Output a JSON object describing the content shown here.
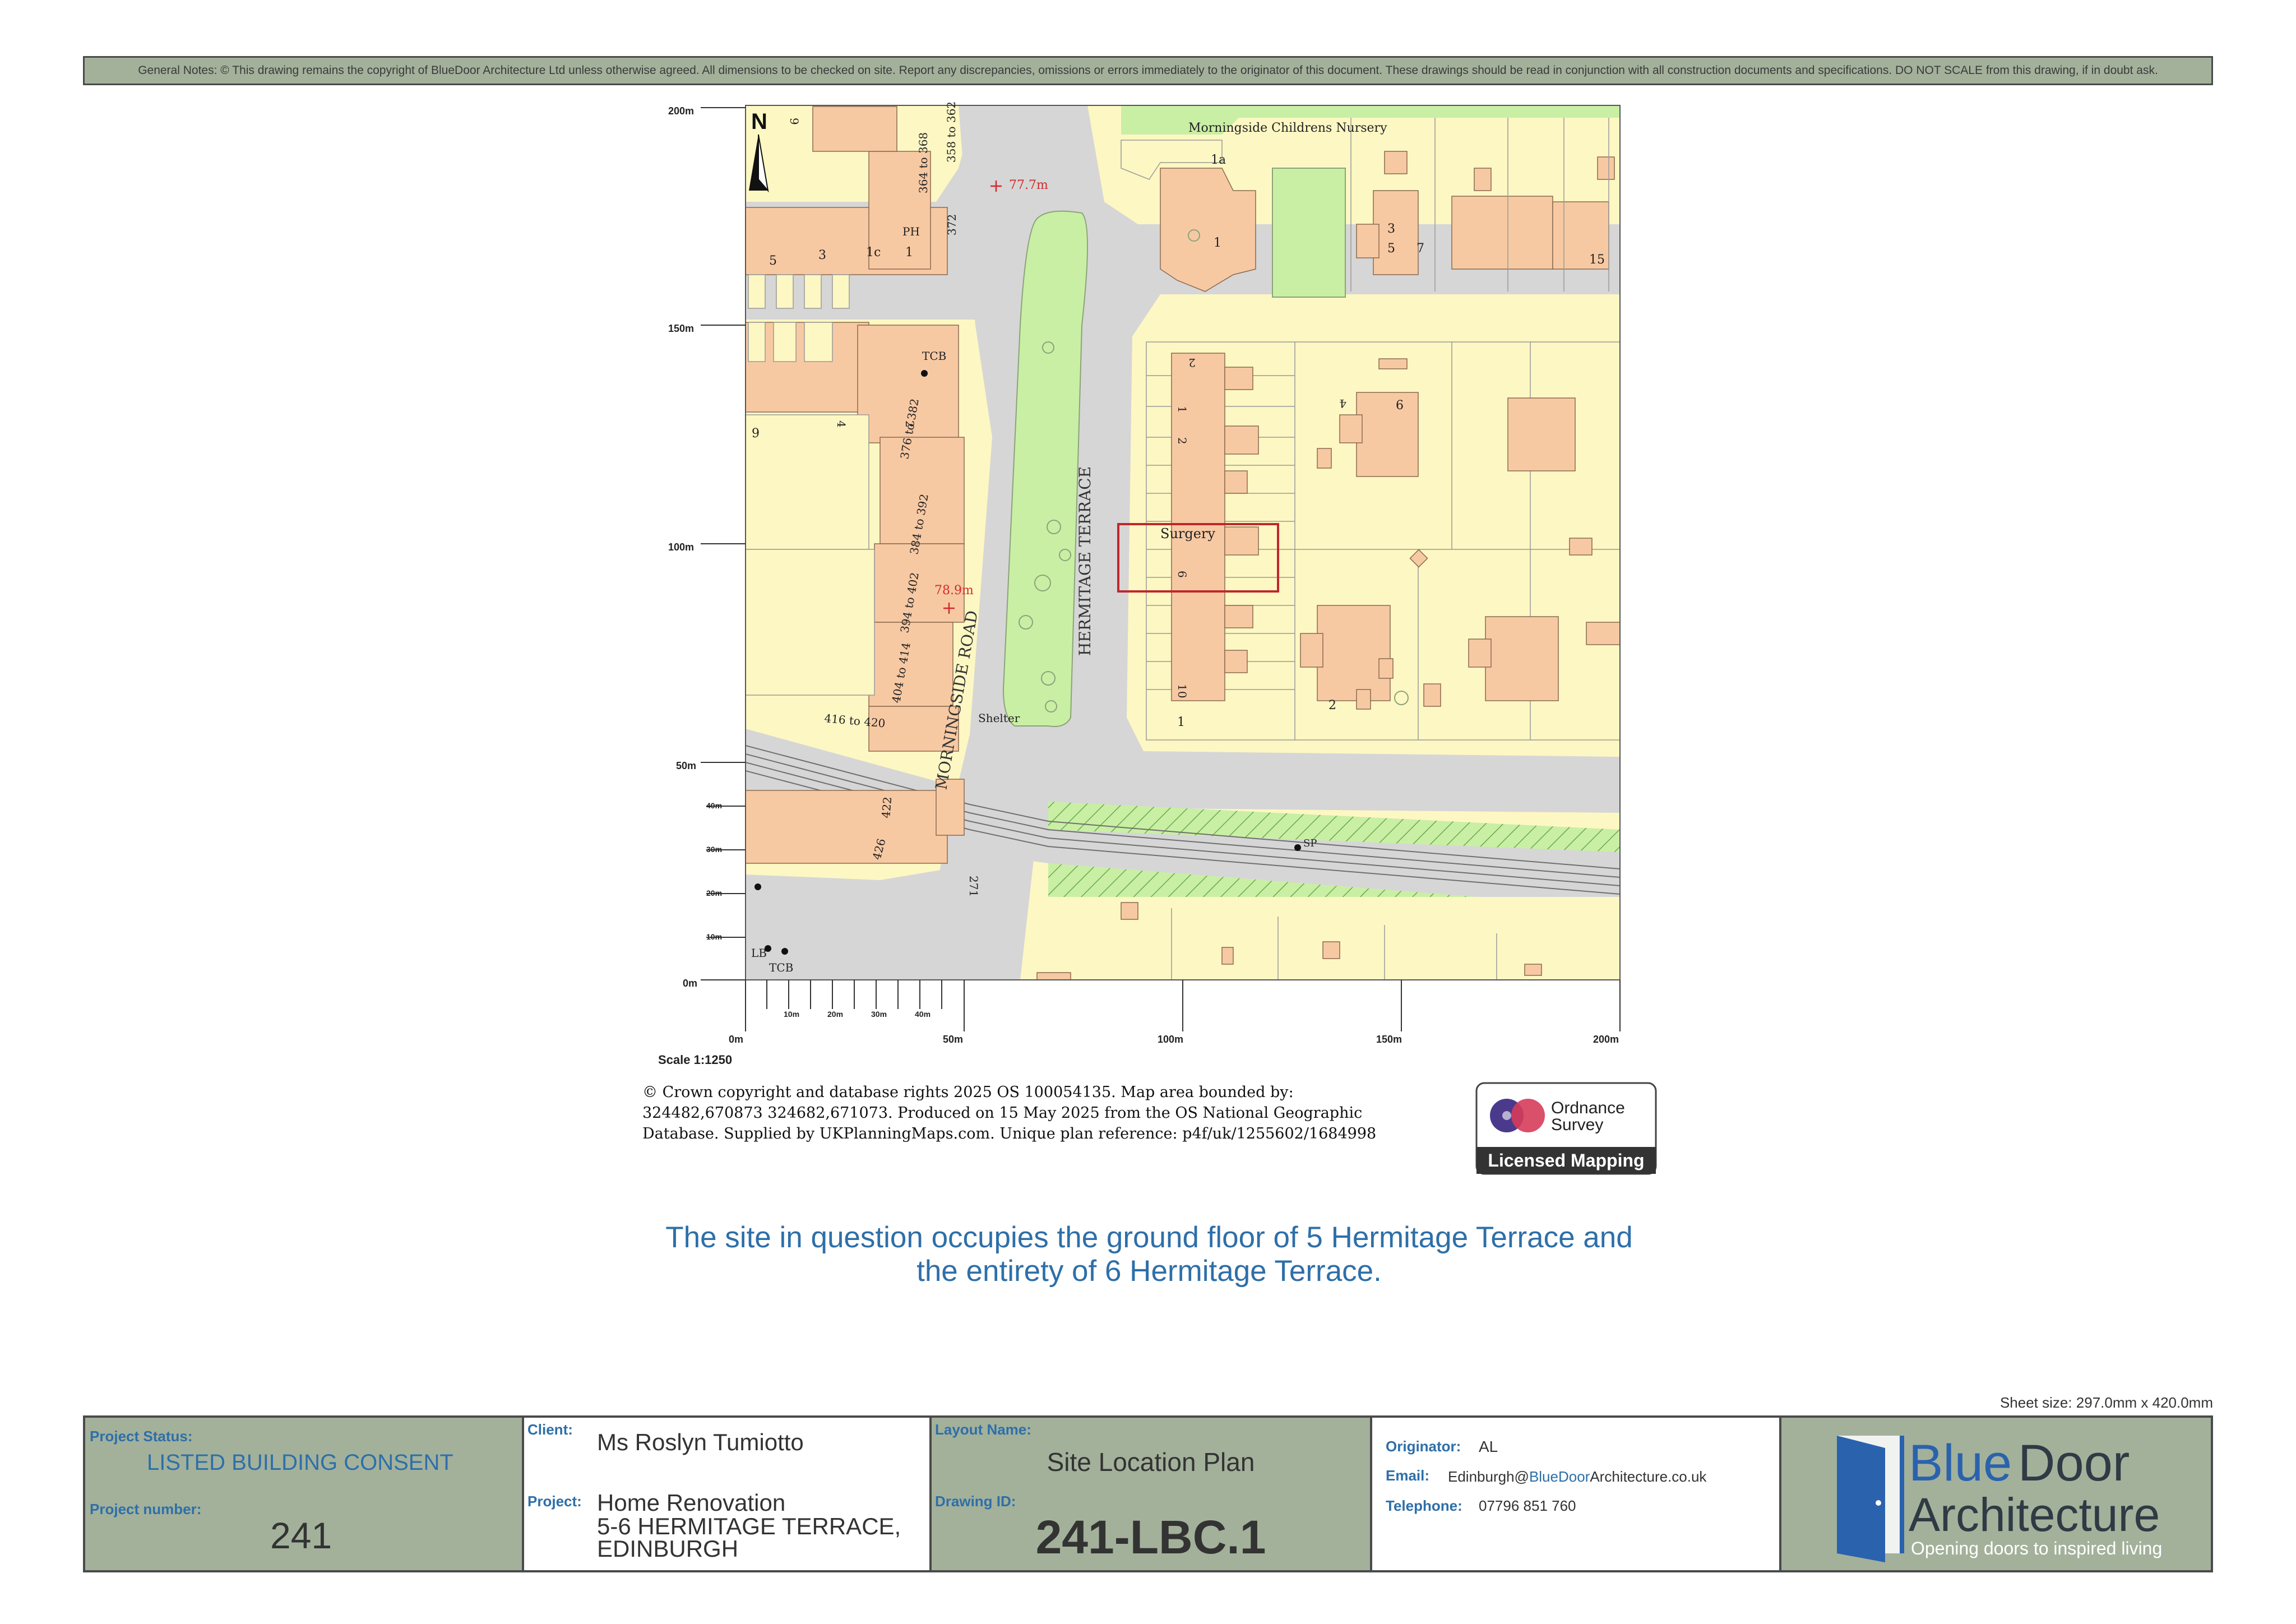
{
  "general_notes": "General Notes: © This drawing remains the copyright of BlueDoor Architecture Ltd unless otherwise agreed. All dimensions to be checked on site. Report any discrepancies, omissions or errors immediately to the originator of this document.  These drawings should be read in conjunction with all construction documents and specifications.   DO NOT SCALE from this drawing, if in doubt ask.",
  "map": {
    "north": "N",
    "scale": "Scale 1:1250",
    "left_scale": [
      "200m",
      "150m",
      "100m",
      "50m",
      "40m",
      "30m",
      "20m",
      "10m",
      "0m"
    ],
    "bottom_scale_major": [
      "0m",
      "50m",
      "100m",
      "150m",
      "200m"
    ],
    "bottom_scale_minor": [
      "10m",
      "20m",
      "30m",
      "40m"
    ],
    "roads": [
      "MORNINGSIDE ROAD",
      "HERMITAGE TERRACE"
    ],
    "spot_heights": [
      "77.7m",
      "78.9m"
    ],
    "labels": {
      "nursery": "Morningside Childrens Nursery",
      "surgery": "Surgery",
      "shelter": "Shelter",
      "tcb": "TCB",
      "ph": "PH",
      "lb": "LB",
      "sp": "SP",
      "n_1a": "1a",
      "n_1": "1",
      "n_3": "3",
      "n_5": "5",
      "n_7": "7",
      "n_15": "15",
      "n_5b": "5",
      "n_3b": "3",
      "n_1c": "1c",
      "n_1b": "1",
      "n_9": "9",
      "n_364": "364 to 368",
      "n_358": "358 to 362",
      "n_372": "372",
      "n_376": "376 to 382",
      "n_384": "384 to 392",
      "n_394": "394 to 402",
      "n_404": "404 to 414",
      "n_416": "416 to 420",
      "n_422": "422",
      "n_426": "426",
      "n_2": "2",
      "n_4": "4",
      "n_h2": "2",
      "n_h1": "1",
      "n_h2b": "2",
      "n_h6": "6",
      "n_h10": "10",
      "n_h1b": "1",
      "n_e4": "4",
      "n_e6": "6",
      "n_e2": "2",
      "n_9b": "9",
      "n_271": "271"
    }
  },
  "copyright": "© Crown copyright and database rights 2025 OS 100054135. Map area bounded by: 324482,670873 324682,671073. Produced on 15 May 2025 from the OS National Geographic Database. Supplied by UKPlanningMaps.com. Unique plan reference: p4f/uk/1255602/1684998",
  "os_logo": {
    "line1": "Ordnance",
    "line2": "Survey",
    "badge": "Licensed Mapping"
  },
  "statement": "The site in question occupies the ground floor of 5 Hermitage Terrace and the entirety of 6 Hermitage Terrace.",
  "sheet_size": "Sheet size: 297.0mm x 420.0mm",
  "title_block": {
    "project_status_label": "Project Status:",
    "project_status": "LISTED BUILDING CONSENT",
    "project_number_label": "Project number:",
    "project_number": "241",
    "client_label": "Client:",
    "client": "Ms Roslyn Tumiotto",
    "project_label": "Project:",
    "project_line1": "Home Renovation",
    "project_line2": "5-6 HERMITAGE TERRACE,",
    "project_line3": "EDINBURGH",
    "layout_label": "Layout Name:",
    "layout": "Site Location Plan",
    "drawing_id_label": "Drawing ID:",
    "drawing_id": "241-LBC.1",
    "originator_label": "Originator:",
    "originator": "AL",
    "email_label": "Email:",
    "email_prefix": "Edinburgh@",
    "email_blue": "BlueDoor",
    "email_suffix": "Architecture.co.uk",
    "telephone_label": "Telephone:",
    "telephone": "07796 851 760"
  },
  "logo": {
    "blue": "Blue",
    "door": "Door",
    "architecture": "Architecture",
    "tagline": "Opening doors to inspired living"
  },
  "colors": {
    "accent_blue": "#2e6fa8",
    "panel_green": "#a3b19b",
    "building": "#f7c9a3",
    "plot": "#fdf7c3",
    "road": "#d6d6d6",
    "park": "#c9efa4",
    "site_outline": "#c0262c"
  }
}
